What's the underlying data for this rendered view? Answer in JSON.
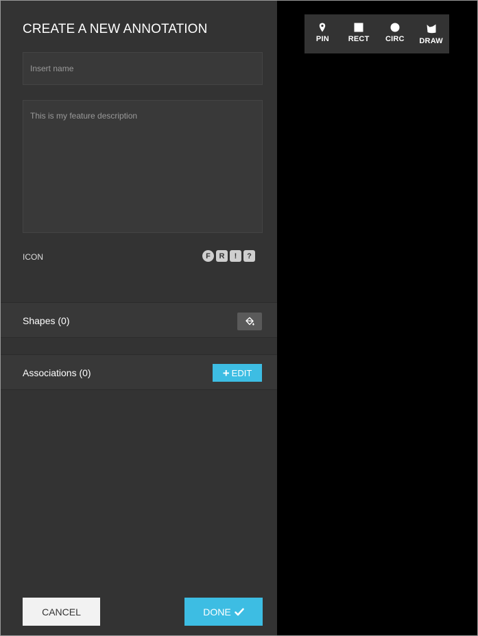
{
  "panel": {
    "title": "CREATE A NEW ANNOTATION",
    "name_placeholder": "Insert name",
    "description_placeholder": "This is my feature description",
    "icon_label": "ICON",
    "icon_choices": [
      "F",
      "R",
      "!",
      "?"
    ]
  },
  "shapes": {
    "title": "Shapes (0)"
  },
  "associations": {
    "title": "Associations (0)",
    "edit_label": "EDIT"
  },
  "footer": {
    "cancel_label": "CANCEL",
    "done_label": "DONE"
  },
  "toolbar": {
    "tools": [
      {
        "label": "PIN",
        "icon": "map-pin-icon"
      },
      {
        "label": "RECT",
        "icon": "square-icon"
      },
      {
        "label": "CIRC",
        "icon": "circle-icon"
      },
      {
        "label": "DRAW",
        "icon": "freehand-draw-icon"
      }
    ]
  },
  "colors": {
    "panel_bg": "#333333",
    "canvas_bg": "#000000",
    "accent": "#3dbde3"
  }
}
